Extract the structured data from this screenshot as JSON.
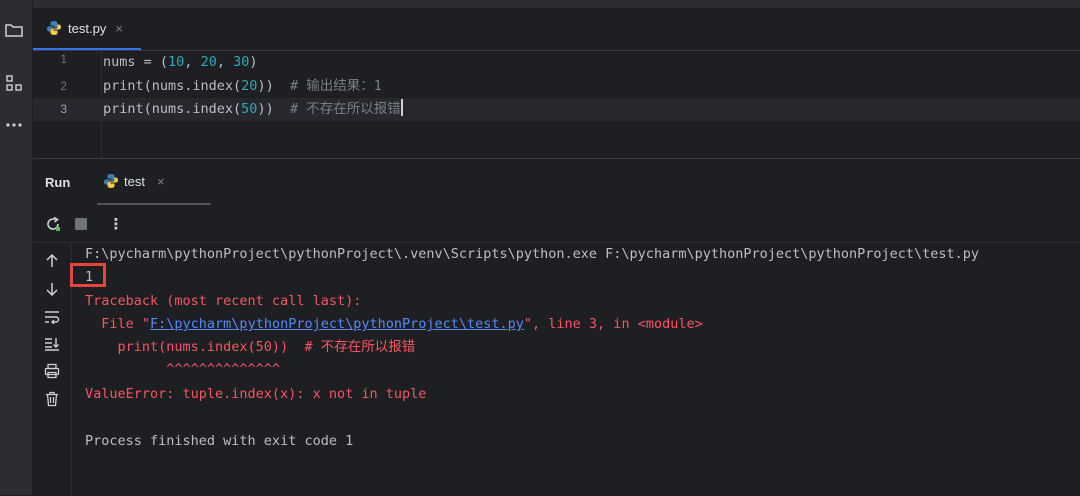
{
  "editor": {
    "tab": {
      "label": "test.py",
      "close": "×"
    },
    "lines": [
      {
        "number": "1",
        "parts": [
          [
            "plain",
            "nums = ("
          ],
          [
            "num",
            "10"
          ],
          [
            "plain",
            ", "
          ],
          [
            "num",
            "20"
          ],
          [
            "plain",
            ", "
          ],
          [
            "num",
            "30"
          ],
          [
            "plain",
            ")"
          ]
        ]
      },
      {
        "number": "2",
        "parts": [
          [
            "plain",
            "print(nums.index("
          ],
          [
            "num",
            "20"
          ],
          [
            "plain",
            "))  "
          ],
          [
            "comment",
            "# 输出结果：1"
          ]
        ]
      },
      {
        "number": "3",
        "parts": [
          [
            "plain",
            "print(nums.index("
          ],
          [
            "num",
            "50"
          ],
          [
            "plain",
            "))  "
          ],
          [
            "comment",
            "# 不存在所以报错"
          ]
        ]
      }
    ]
  },
  "run": {
    "title": "Run",
    "tab": {
      "label": "test",
      "close": "×"
    },
    "toolbar": {
      "more_label": "⋮"
    }
  },
  "console": {
    "command": "F:\\pycharm\\pythonProject\\pythonProject\\.venv\\Scripts\\python.exe F:\\pycharm\\pythonProject\\pythonProject\\test.py",
    "output_value": "1",
    "traceback_header": "Traceback (most recent call last):",
    "file_prefix": "  File \"",
    "file_link": "F:\\pycharm\\pythonProject\\pythonProject\\test.py",
    "file_suffix": "\", line 3, in <module>",
    "code_line": "    print(nums.index(50))  # 不存在所以报错",
    "carets": "          ^^^^^^^^^^^^^^",
    "error": "ValueError: tuple.index(x): x not in tuple",
    "finished": "Process finished with exit code 1"
  },
  "colors": {
    "accent": "#3574f0",
    "error": "#f75464",
    "highlight_box": "#e2463f",
    "number": "#2aacb8",
    "comment": "#7a7e85"
  }
}
